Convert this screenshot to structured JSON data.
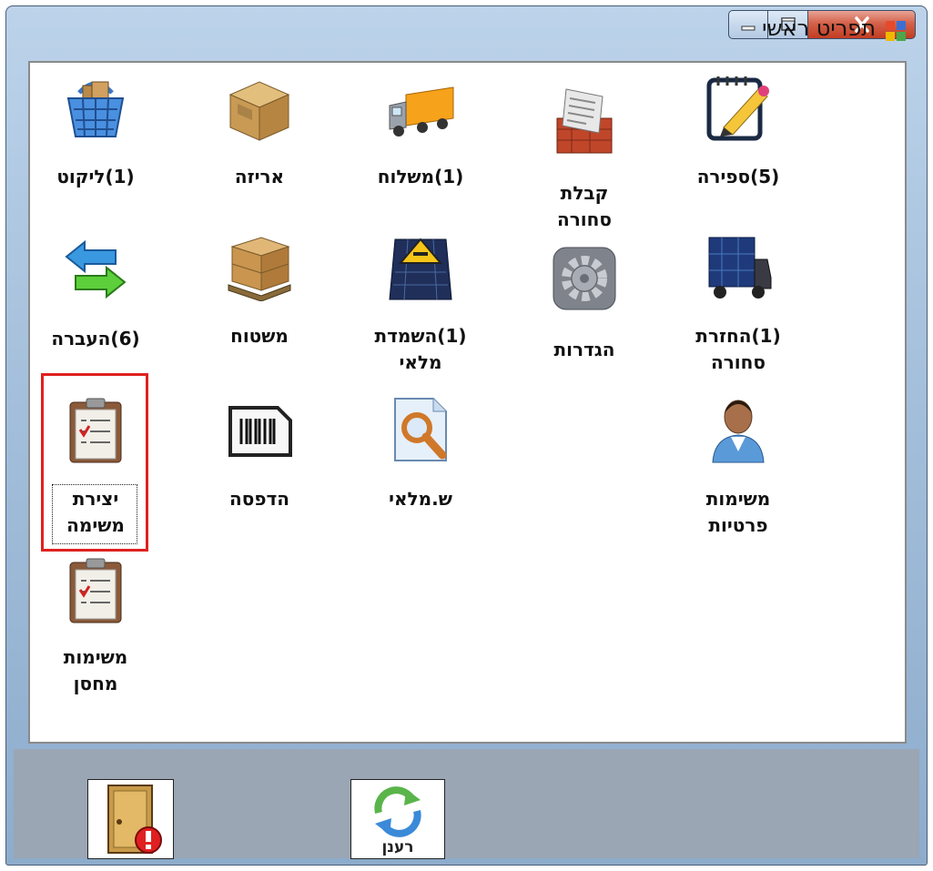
{
  "window": {
    "title": "תפריט ראשי",
    "controls": [
      "minimize",
      "maximize",
      "close"
    ],
    "app_icon": "windows-app-icon"
  },
  "menu_items": [
    {
      "id": "likut",
      "label": "(1)ליקוט",
      "icon": "shopping-basket-icon"
    },
    {
      "id": "ariza",
      "label": "אריזה",
      "icon": "box-icon"
    },
    {
      "id": "mishloach",
      "label": "(1)משלוח",
      "icon": "truck-icon"
    },
    {
      "id": "kabalat",
      "label": "קבלת\nסחורה",
      "icon": "receiving-document-icon"
    },
    {
      "id": "sfira",
      "label": "(5)ספירה",
      "icon": "notepad-pencil-icon"
    },
    {
      "id": "haavara",
      "label": "(6)העברה",
      "icon": "transfer-arrows-icon"
    },
    {
      "id": "mishtach",
      "label": "משטוח",
      "icon": "pallet-boxes-icon"
    },
    {
      "id": "hashmadat",
      "label": "(1)השמדת\nמלאי",
      "icon": "hazard-container-icon"
    },
    {
      "id": "hagdarot",
      "label": "הגדרות",
      "icon": "settings-gear-icon"
    },
    {
      "id": "hachzarat",
      "label": "(1)החזרת\nסחורה",
      "icon": "container-truck-icon"
    },
    {
      "id": "yetzirat",
      "label": "יצירת\nמשימה",
      "icon": "clipboard-checklist-icon"
    },
    {
      "id": "hadpasa",
      "label": "הדפסה",
      "icon": "barcode-icon"
    },
    {
      "id": "shmalay",
      "label": "ש.מלאי",
      "icon": "document-search-icon"
    },
    {
      "id": "mesimot_pratiot",
      "label": "משימות\nפרטיות",
      "icon": "person-icon"
    },
    {
      "id": "mesimot_machsan",
      "label": "משימות\nמחסן",
      "icon": "clipboard-checklist-icon"
    }
  ],
  "selected_item": "יצירת משימה",
  "bottom_buttons": {
    "exit": {
      "icon": "exit-door-icon"
    },
    "refresh": {
      "label": "רענן",
      "icon": "refresh-arrows-icon"
    }
  },
  "colors": {
    "highlight": "#e02020",
    "title_bar": "#a4bfdb",
    "bottom_panel": "#9aa6b4"
  }
}
